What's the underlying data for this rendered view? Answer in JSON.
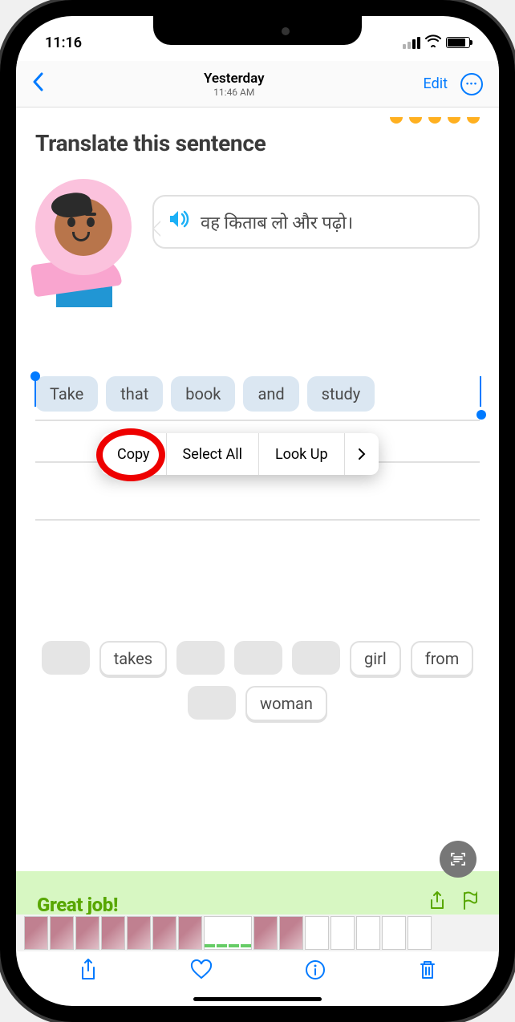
{
  "status": {
    "time": "11:16"
  },
  "nav": {
    "title": "Yesterday",
    "subtitle": "11:46 AM",
    "edit": "Edit"
  },
  "lesson": {
    "prompt": "Translate this sentence",
    "sentence": "वह किताब लो और पढ़ो।"
  },
  "context_menu": {
    "copy": "Copy",
    "select_all": "Select All",
    "look_up": "Look Up"
  },
  "answer": {
    "w1": "Take",
    "w2": "that",
    "w3": "book",
    "w4": "and",
    "w5": "study"
  },
  "bank": {
    "takes": "takes",
    "girl": "girl",
    "from": "from",
    "woman": "woman"
  },
  "feedback": {
    "text": "Great job!"
  }
}
